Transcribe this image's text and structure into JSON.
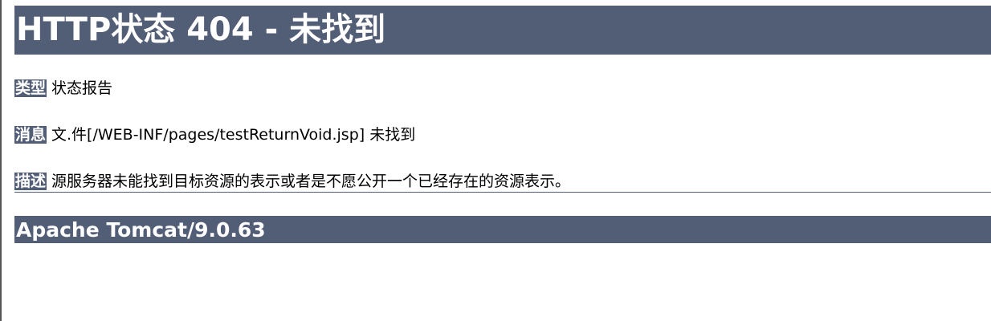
{
  "page": {
    "title": "HTTP状态 404 - 未找到"
  },
  "report": {
    "type": {
      "label": "类型",
      "value": "状态报告"
    },
    "message": {
      "label": "消息",
      "value": "文.件[/WEB-INF/pages/testReturnVoid.jsp] 未找到"
    },
    "description": {
      "label": "描述",
      "value": "源服务器未能找到目标资源的表示或者是不愿公开一个已经存在的资源表示。"
    }
  },
  "footer": {
    "server": "Apache Tomcat/9.0.63"
  },
  "colors": {
    "header_bg": "#525d76",
    "header_text": "#ffffff"
  }
}
